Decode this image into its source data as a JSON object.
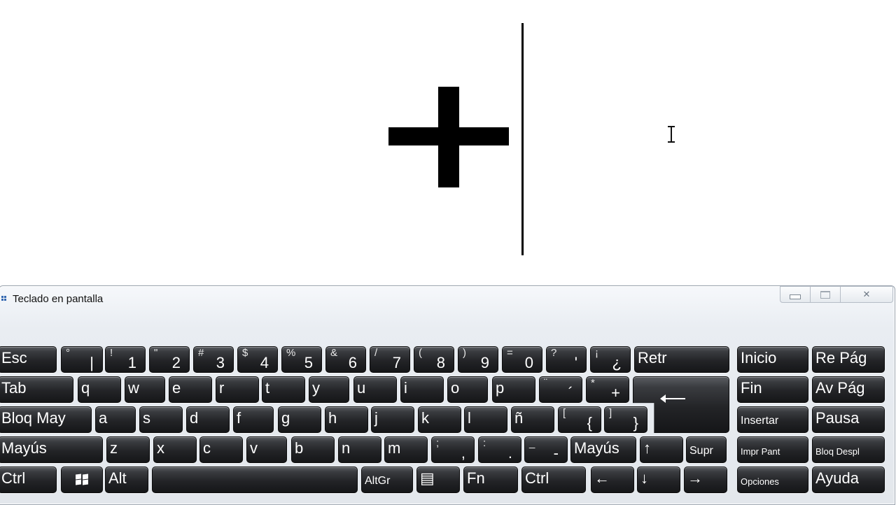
{
  "window": {
    "title": "Teclado en pantalla",
    "controls": {
      "minimize": "",
      "maximize": "",
      "close": "✕"
    }
  },
  "keyboard": {
    "rows": [
      [
        {
          "label": "Esc"
        },
        {
          "shift": "°",
          "label": "|"
        },
        {
          "shift": "!",
          "label": "1"
        },
        {
          "shift": "\"",
          "label": "2"
        },
        {
          "shift": "#",
          "label": "3"
        },
        {
          "shift": "$",
          "label": "4"
        },
        {
          "shift": "%",
          "label": "5"
        },
        {
          "shift": "&",
          "label": "6"
        },
        {
          "shift": "/",
          "label": "7"
        },
        {
          "shift": "(",
          "label": "8"
        },
        {
          "shift": ")",
          "label": "9"
        },
        {
          "shift": "=",
          "label": "0"
        },
        {
          "shift": "?",
          "label": "'"
        },
        {
          "shift": "¡",
          "label": "¿"
        },
        {
          "label": "Retr"
        },
        {
          "label": "Inicio"
        },
        {
          "label": "Re Pág"
        }
      ],
      [
        {
          "label": "Tab"
        },
        {
          "label": "q"
        },
        {
          "label": "w"
        },
        {
          "label": "e"
        },
        {
          "label": "r"
        },
        {
          "label": "t"
        },
        {
          "label": "y"
        },
        {
          "label": "u"
        },
        {
          "label": "i"
        },
        {
          "label": "o"
        },
        {
          "label": "p"
        },
        {
          "shift": "¨",
          "label": "´"
        },
        {
          "shift": "*",
          "label": "+"
        },
        {
          "label": "⟵"
        },
        {
          "label": "Fin"
        },
        {
          "label": "Av Pág"
        }
      ],
      [
        {
          "label": "Bloq May"
        },
        {
          "label": "a"
        },
        {
          "label": "s"
        },
        {
          "label": "d"
        },
        {
          "label": "f"
        },
        {
          "label": "g"
        },
        {
          "label": "h"
        },
        {
          "label": "j"
        },
        {
          "label": "k"
        },
        {
          "label": "l"
        },
        {
          "label": "ñ"
        },
        {
          "shift": "[",
          "label": "{"
        },
        {
          "shift": "]",
          "label": "}"
        },
        {
          "label": "Insertar"
        },
        {
          "label": "Pausa"
        }
      ],
      [
        {
          "label": "Mayús"
        },
        {
          "label": "z"
        },
        {
          "label": "x"
        },
        {
          "label": "c"
        },
        {
          "label": "v"
        },
        {
          "label": "b"
        },
        {
          "label": "n"
        },
        {
          "label": "m"
        },
        {
          "shift": ";",
          "label": ","
        },
        {
          "shift": ":",
          "label": "."
        },
        {
          "shift": "_",
          "label": "-"
        },
        {
          "label": "Mayús"
        },
        {
          "label": "↑"
        },
        {
          "label": "Supr"
        },
        {
          "label": "Impr Pant"
        },
        {
          "label": "Bloq Despl"
        }
      ],
      [
        {
          "label": "Ctrl"
        },
        {
          "label": ""
        },
        {
          "label": "Alt"
        },
        {
          "label": ""
        },
        {
          "label": "AltGr"
        },
        {
          "label": "▤"
        },
        {
          "label": "Fn"
        },
        {
          "label": "Ctrl"
        },
        {
          "label": "←"
        },
        {
          "label": "↓"
        },
        {
          "label": "→"
        },
        {
          "label": "Opciones"
        },
        {
          "label": "Ayuda"
        }
      ]
    ]
  }
}
